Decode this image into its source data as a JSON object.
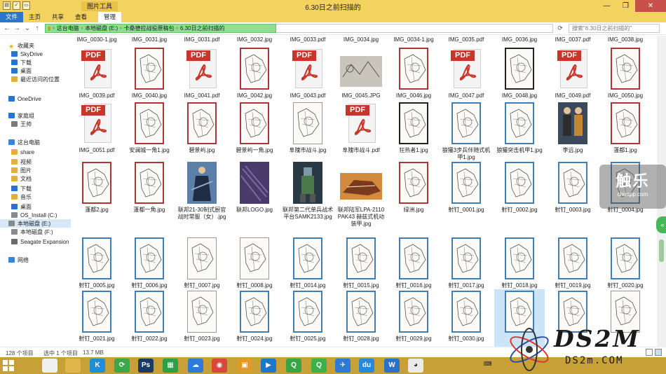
{
  "window": {
    "title": "6.30日之前扫描的",
    "context_tab_title": "图片工具",
    "controls": [
      "—",
      "❐",
      "✕"
    ]
  },
  "ribbon": {
    "tabs": [
      "文件",
      "主页",
      "共享",
      "查看",
      "管理"
    ]
  },
  "address": {
    "segments": [
      "这台电脑",
      "本地磁盘 (E:)",
      "卡桑德拉战役原稿包",
      "6.30日之前扫描的"
    ],
    "search_placeholder": "搜索\"6.30日之前扫描的\""
  },
  "sidebar": {
    "items": [
      {
        "label": "收藏夹",
        "icon": "star-icon"
      },
      {
        "label": "SkyDrive",
        "icon": "cloud-icon"
      },
      {
        "label": "下载",
        "icon": "folder-download-icon"
      },
      {
        "label": "桌面",
        "icon": "desktop-icon"
      },
      {
        "label": "最近访问的位置",
        "icon": "recent-places-icon"
      },
      {
        "label": "OneDrive",
        "icon": "cloud-icon"
      },
      {
        "label": "家庭组",
        "icon": "homegroup-icon"
      },
      {
        "label": "王帅",
        "icon": "user-icon"
      },
      {
        "label": "这台电脑",
        "icon": "computer-icon"
      },
      {
        "label": "share",
        "icon": "folder-icon"
      },
      {
        "label": "视频",
        "icon": "video-folder-icon"
      },
      {
        "label": "图片",
        "icon": "pictures-folder-icon"
      },
      {
        "label": "文档",
        "icon": "documents-folder-icon"
      },
      {
        "label": "下载",
        "icon": "folder-download-icon"
      },
      {
        "label": "音乐",
        "icon": "music-folder-icon"
      },
      {
        "label": "桌面",
        "icon": "desktop-icon"
      },
      {
        "label": "OS_Install (C:)",
        "icon": "drive-icon"
      },
      {
        "label": "本地磁盘 (E:)",
        "icon": "drive-icon"
      },
      {
        "label": "本地磁盘 (F:)",
        "icon": "drive-icon"
      },
      {
        "label": "Seagate Expansion",
        "icon": "external-drive-icon"
      },
      {
        "label": "网络",
        "icon": "network-icon"
      }
    ]
  },
  "files": {
    "row0": [
      "IMG_0030-1.jpg",
      "IMG_0031.jpg",
      "IMG_0031.pdf",
      "IMG_0032.jpg",
      "IMG_0033.pdf",
      "IMG_0034.jpg",
      "IMG_0034-1.jpg",
      "IMG_0035.pdf",
      "IMG_0036.jpg",
      "IMG_0037.pdf",
      "IMG_0038.jpg"
    ],
    "row1": [
      {
        "name": "IMG_0039.pdf",
        "kind": "pdf"
      },
      {
        "name": "IMG_0040.jpg",
        "kind": "red"
      },
      {
        "name": "IMG_0041.pdf",
        "kind": "pdf"
      },
      {
        "name": "IMG_0042.jpg",
        "kind": "red"
      },
      {
        "name": "IMG_0043.pdf",
        "kind": "pdf"
      },
      {
        "name": "IMG_0045.JPG",
        "kind": "photo-gray"
      },
      {
        "name": "IMG_0046.jpg",
        "kind": "red"
      },
      {
        "name": "IMG_0047.pdf",
        "kind": "pdf"
      },
      {
        "name": "IMG_0048.jpg",
        "kind": "black"
      },
      {
        "name": "IMG_0049.pdf",
        "kind": "pdf"
      },
      {
        "name": "IMG_0050.jpg",
        "kind": "red"
      }
    ],
    "row2": [
      {
        "name": "IMG_0051.pdf",
        "kind": "pdf"
      },
      {
        "name": "安澜城一角1.jpg",
        "kind": "red"
      },
      {
        "name": "碧景屿.jpg",
        "kind": "red"
      },
      {
        "name": "碧景屿一角.jpg",
        "kind": "red"
      },
      {
        "name": "阜隗市战斗.jpg",
        "kind": "plain"
      },
      {
        "name": "阜隗市战斗.pdf",
        "kind": "pdf"
      },
      {
        "name": "狂热者1.jpg",
        "kind": "black"
      },
      {
        "name": "狼獾3步兵伴随式机甲1.jpg",
        "kind": "blue"
      },
      {
        "name": "狼獾突击机甲1.jpg",
        "kind": "blue"
      },
      {
        "name": "李远.jpg",
        "kind": "photo-people"
      },
      {
        "name": "蓬都1.jpg",
        "kind": "red"
      }
    ],
    "row3": [
      {
        "name": "蓬都2.jpg",
        "kind": "red"
      },
      {
        "name": "蓬都一角.jpg",
        "kind": "red"
      },
      {
        "name": "联邦21-30制式厨官战时常服（女）.jpg",
        "kind": "photo-blue"
      },
      {
        "name": "联邦LOGO.jpg",
        "kind": "photo-purple"
      },
      {
        "name": "联邦第二代单兵战术平台SAMK2133.jpg",
        "kind": "photo-dark"
      },
      {
        "name": "联邦陆军LPA-2110 PAK43 赫兹式机动装甲.jpg",
        "kind": "photo-orange"
      },
      {
        "name": "绿洲.jpg",
        "kind": "red"
      },
      {
        "name": "射钉_0001.jpg",
        "kind": "blue"
      },
      {
        "name": "射钉_0002.jpg",
        "kind": "blue"
      },
      {
        "name": "射钉_0003.jpg",
        "kind": "blue"
      },
      {
        "name": "射钉_0004.jpg",
        "kind": "blue"
      }
    ],
    "row4": [
      {
        "name": "射钉_0005.jpg",
        "kind": "blue"
      },
      {
        "name": "射钉_0006.jpg",
        "kind": "blue"
      },
      {
        "name": "射钉_0007.jpg",
        "kind": "plain"
      },
      {
        "name": "射钉_0008.jpg",
        "kind": "plain"
      },
      {
        "name": "射钉_0014.jpg",
        "kind": "blue"
      },
      {
        "name": "射钉_0015.jpg",
        "kind": "blue"
      },
      {
        "name": "射钉_0016.jpg",
        "kind": "blue"
      },
      {
        "name": "射钉_0017.jpg",
        "kind": "blue"
      },
      {
        "name": "射钉_0018.jpg",
        "kind": "blue"
      },
      {
        "name": "射钉_0019.jpg",
        "kind": "blue"
      },
      {
        "name": "射钉_0020.jpg",
        "kind": "blue"
      }
    ],
    "row5": [
      {
        "name": "射钉_0021.jpg",
        "kind": "blue"
      },
      {
        "name": "射钉_0022.jpg",
        "kind": "blue"
      },
      {
        "name": "射钉_0023.jpg",
        "kind": "plain"
      },
      {
        "name": "射钉_0024.jpg",
        "kind": "blue"
      },
      {
        "name": "射钉_0025.jpg",
        "kind": "blue"
      },
      {
        "name": "射钉_0028.jpg",
        "kind": "blue"
      },
      {
        "name": "射钉_0029.jpg",
        "kind": "blue"
      },
      {
        "name": "射钉_0030.jpg",
        "kind": "blue"
      },
      {
        "name": "",
        "kind": "blue-selected"
      },
      {
        "name": "",
        "kind": "blue"
      },
      {
        "name": "",
        "kind": "plain"
      }
    ]
  },
  "status": {
    "item_count": "128 个项目",
    "selected": "选中 1 个项目",
    "size": "13.7 MB"
  },
  "taskbar": {
    "apps": [
      {
        "name": "file-manager-icon",
        "glyph": "",
        "color": "#f0f0f0"
      },
      {
        "name": "file-explorer-icon",
        "glyph": "",
        "color": "#e0b64a"
      },
      {
        "name": "kk-app-icon",
        "glyph": "K",
        "color": "#1e8fd6"
      },
      {
        "name": "refresh-app-icon",
        "glyph": "⟳",
        "color": "#3ea64a"
      },
      {
        "name": "photoshop-icon",
        "glyph": "Ps",
        "color": "#1c3a66"
      },
      {
        "name": "store-icon",
        "glyph": "▦",
        "color": "#2aa146"
      },
      {
        "name": "baidu-netdisk-icon",
        "glyph": "☁",
        "color": "#2f7ad6"
      },
      {
        "name": "chrome-icon",
        "glyph": "◉",
        "color": "#d9473b"
      },
      {
        "name": "game-box-icon",
        "glyph": "▣",
        "color": "#e09a2c"
      },
      {
        "name": "media-player-icon",
        "glyph": "▶",
        "color": "#1f77c9"
      },
      {
        "name": "iqiyi-icon",
        "glyph": "Q",
        "color": "#35a845"
      },
      {
        "name": "iqiyi-video-icon",
        "glyph": "Q",
        "color": "#3cb14a"
      },
      {
        "name": "bird-app-icon",
        "glyph": "✈",
        "color": "#2f7ad6"
      },
      {
        "name": "cloud-drive-icon",
        "glyph": "du",
        "color": "#2a88dc"
      },
      {
        "name": "wps-writer-icon",
        "glyph": "W",
        "color": "#2a71c8"
      },
      {
        "name": "puppy-app-icon",
        "glyph": "◕",
        "color": "#eaeaea"
      }
    ],
    "tray_keyboard": "⌨"
  },
  "watermarks": {
    "chuapp_main": "触乐",
    "chuapp_url": "chuapp.com",
    "ds2m_logo": "DS2M",
    "ds2m_url": "DS2m.COM"
  },
  "colors": {
    "title_bar": "#f3d25f",
    "file_tab": "#2e74c8",
    "address_highlight": "#8ee08f",
    "pdf_red": "#c8352b",
    "taskbar": "#c7a037"
  }
}
